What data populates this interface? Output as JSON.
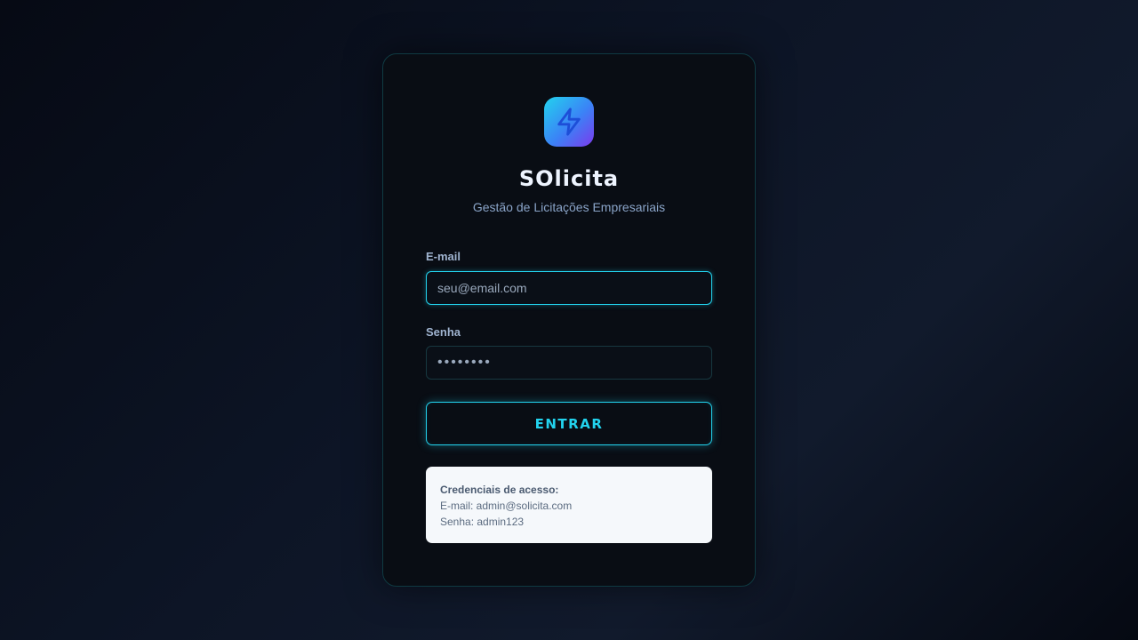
{
  "app": {
    "title": "SOlicita",
    "subtitle": "Gestão de Licitações Empresariais",
    "logo_icon": "lightning-bolt-icon"
  },
  "form": {
    "email_label": "E-mail",
    "email_placeholder": "seu@email.com",
    "email_value": "",
    "password_label": "Senha",
    "password_value": "••••••••",
    "submit_label": "ENTRAR"
  },
  "credentials": {
    "title": "Credenciais de acesso:",
    "email_line": "E-mail: admin@solicita.com",
    "password_line": "Senha: admin123"
  },
  "colors": {
    "accent": "#22d3ee",
    "card_background": "#090d14",
    "logo_gradient_start": "#22d3ee",
    "logo_gradient_end": "#7c3aed"
  }
}
